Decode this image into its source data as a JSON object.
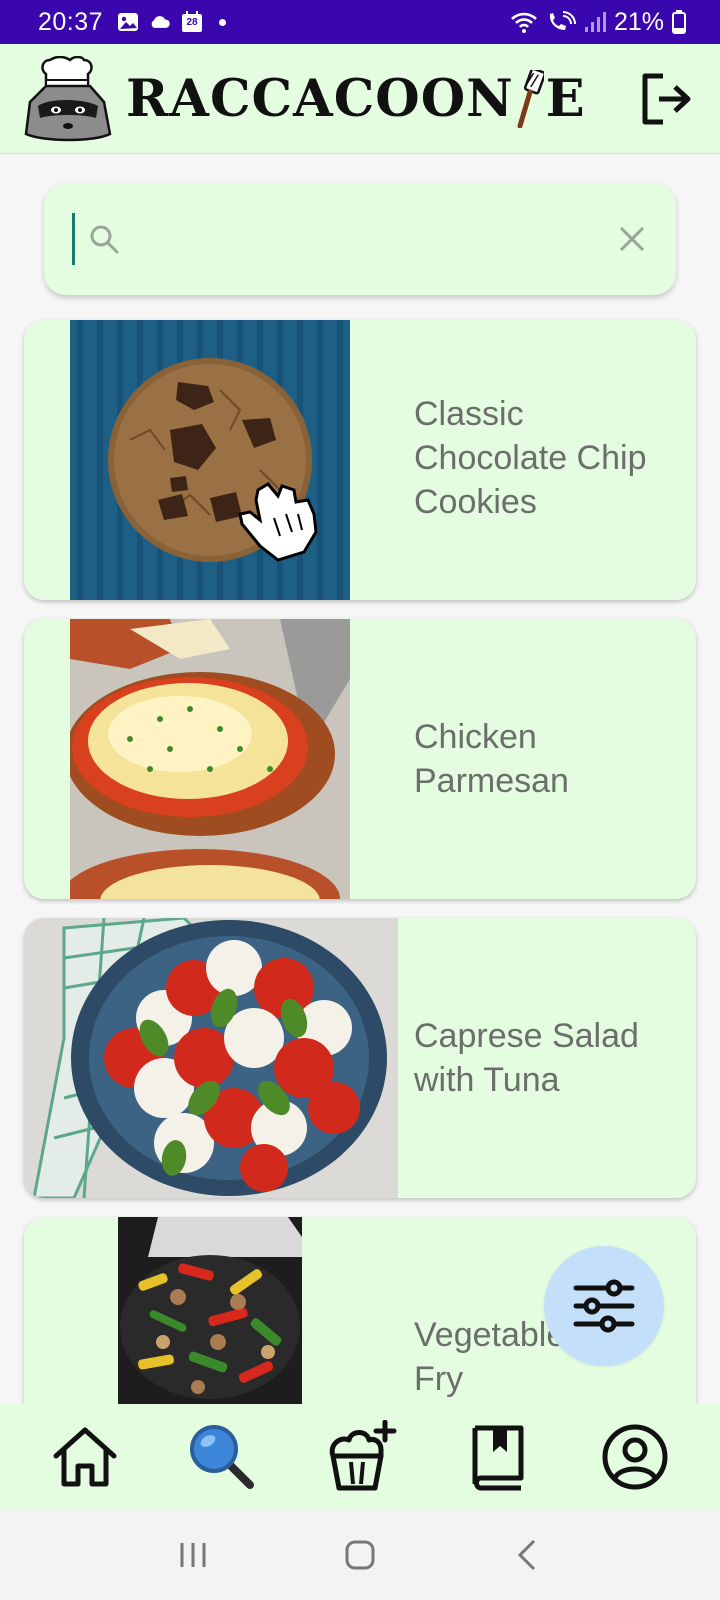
{
  "status_bar": {
    "time": "20:37",
    "calendar_day": "28",
    "battery": "21%",
    "icons": [
      "image-icon",
      "cloud-icon",
      "calendar-icon",
      "dot-icon",
      "wifi-icon",
      "wifi-call-icon",
      "signal-icon",
      "battery-icon"
    ]
  },
  "header": {
    "brand_part1": "RACCACOON",
    "brand_part2": "E",
    "logout_icon": "logout-icon"
  },
  "search": {
    "value": "",
    "placeholder": "",
    "search_icon": "search-icon",
    "clear_icon": "close-icon"
  },
  "recipes": [
    {
      "title": "Classic Chocolate Chip Cookies",
      "image": "cookie-photo"
    },
    {
      "title": "Chicken Parmesan",
      "image": "chicken-parmesan-photo"
    },
    {
      "title": "Caprese Salad with Tuna",
      "image": "caprese-salad-photo"
    },
    {
      "title": "Vegetable Stir-Fry",
      "image": "stir-fry-photo"
    }
  ],
  "fab": {
    "icon": "filter-sliders-icon"
  },
  "bottom_nav": [
    {
      "name": "home",
      "icon": "home-icon"
    },
    {
      "name": "search",
      "icon": "magnifier-icon",
      "active": true
    },
    {
      "name": "add-recipe",
      "icon": "cupcake-plus-icon"
    },
    {
      "name": "cookbook",
      "icon": "book-icon"
    },
    {
      "name": "profile",
      "icon": "user-circle-icon"
    }
  ],
  "system_nav": [
    "recent-apps-icon",
    "home-button-icon",
    "back-icon"
  ],
  "colors": {
    "status_bar": "#3a06ad",
    "surface": "#e4fce0",
    "fab": "#c4dffa",
    "title_text": "#6b6f6a",
    "caret": "#127a6e"
  }
}
